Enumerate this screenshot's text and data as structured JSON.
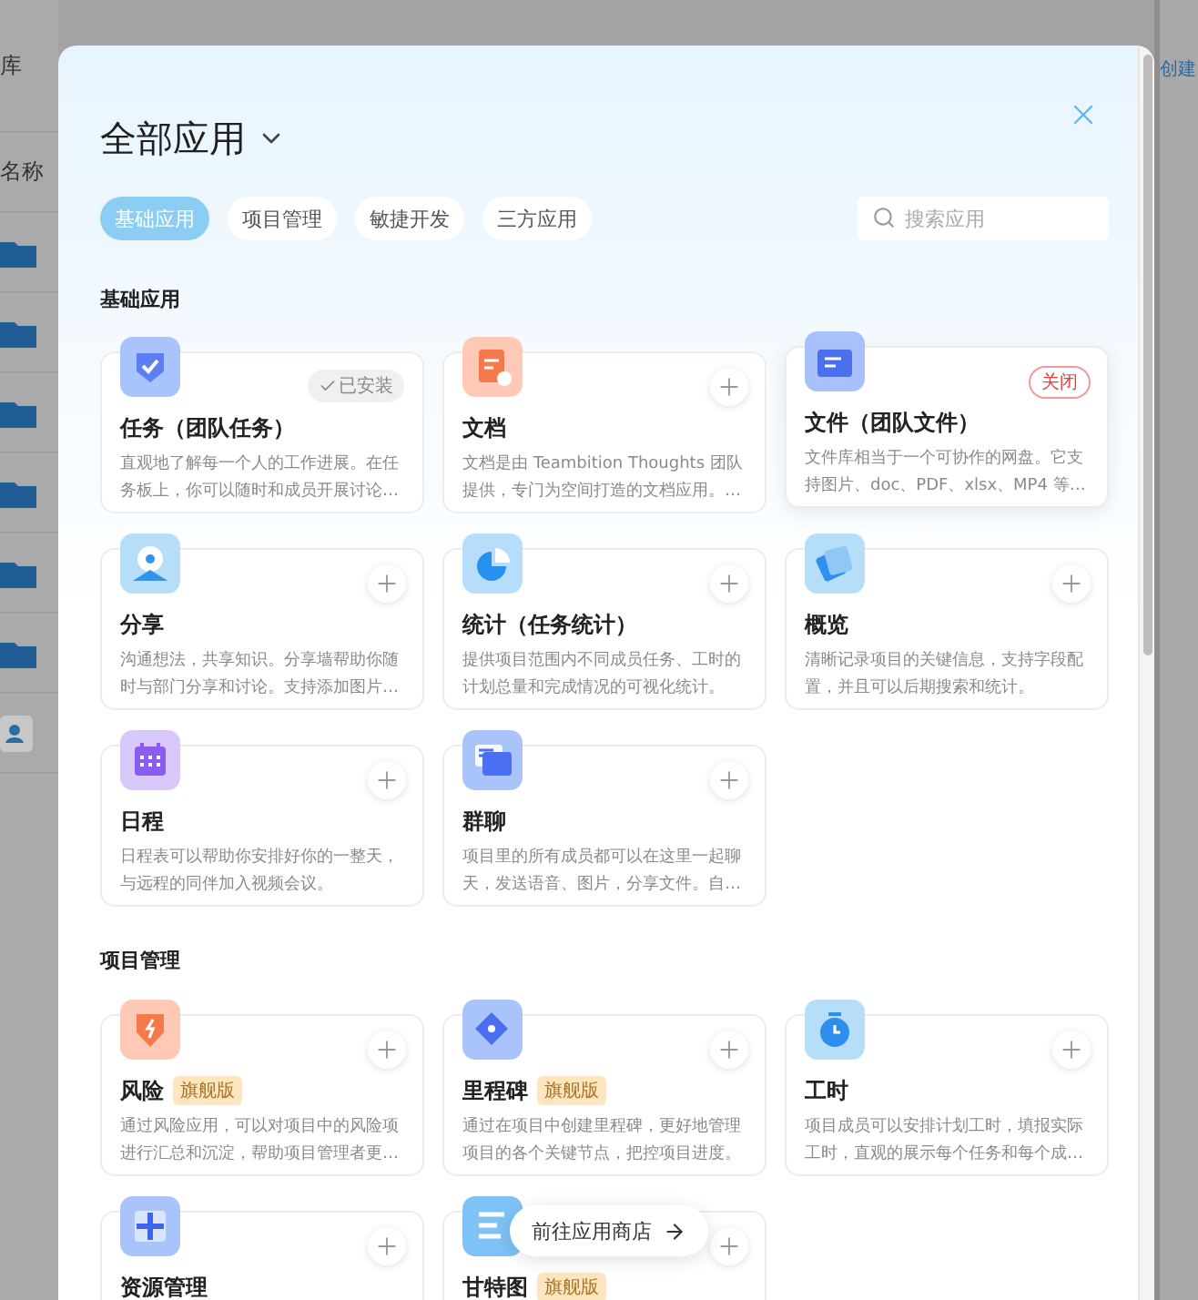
{
  "background": {
    "left_texts": [
      "库",
      "名称"
    ],
    "right_link": "创建"
  },
  "dialog": {
    "title": "全部应用",
    "tabs": [
      {
        "label": "基础应用",
        "selected": true
      },
      {
        "label": "项目管理",
        "selected": false
      },
      {
        "label": "敏捷开发",
        "selected": false
      },
      {
        "label": "三方应用",
        "selected": false
      }
    ],
    "search": {
      "placeholder": "搜索应用"
    },
    "sections": [
      {
        "title": "基础应用",
        "apps": [
          {
            "name": "任务（团队任务）",
            "description": "直观地了解每一个人的工作进展。在任务板上，你可以随时和成员开展讨论…",
            "kind": "installed",
            "status_label": "已安装",
            "raised": false
          },
          {
            "name": "文档",
            "description": "文档是由 Teambition Thoughts 团队提供，专门为空间打造的文档应用。…",
            "kind": "addable",
            "raised": false
          },
          {
            "name": "文件（团队文件）",
            "description": "文件库相当于一个可协作的网盘。它支持图片、doc、PDF、xlsx、MP4 等…",
            "kind": "closable",
            "status_label": "关闭",
            "raised": true
          },
          {
            "name": "分享",
            "description": "沟通想法，共享知识。分享墙帮助你随时与部门分享和讨论。支持添加图片…",
            "kind": "addable",
            "raised": false
          },
          {
            "name": "统计（任务统计）",
            "description": "提供项目范围内不同成员任务、工时的计划总量和完成情况的可视化统计。",
            "kind": "addable",
            "raised": false
          },
          {
            "name": "概览",
            "description": "清晰记录项目的关键信息，支持字段配置，并且可以后期搜索和统计。",
            "kind": "addable",
            "raised": false
          },
          {
            "name": "日程",
            "description": "日程表可以帮助你安排好你的一整天，与远程的同伴加入视频会议。",
            "kind": "addable",
            "raised": false
          },
          {
            "name": "群聊",
            "description": "项目里的所有成员都可以在这里一起聊天，发送语音、图片，分享文件。自…",
            "kind": "addable",
            "raised": false
          }
        ]
      },
      {
        "title": "项目管理",
        "apps": [
          {
            "name": "风险",
            "tag": "旗舰版",
            "description": "通过风险应用，可以对项目中的风险项进行汇总和沉淀，帮助项目管理者更…",
            "kind": "addable",
            "raised": false
          },
          {
            "name": "里程碑",
            "tag": "旗舰版",
            "description": "通过在项目中创建里程碑，更好地管理项目的各个关键节点，把控项目进度。",
            "kind": "addable",
            "raised": false
          },
          {
            "name": "工时",
            "description": "项目成员可以安排计划工时，填报实际工时，直观的展示每个任务和每个成…",
            "kind": "addable",
            "raised": false
          },
          {
            "name": "资源管理",
            "kind": "addable",
            "raised": false
          },
          {
            "name": "甘特图",
            "tag": "旗舰版",
            "kind": "addable",
            "raised": false
          }
        ]
      }
    ],
    "store_link": "前往应用商店"
  }
}
